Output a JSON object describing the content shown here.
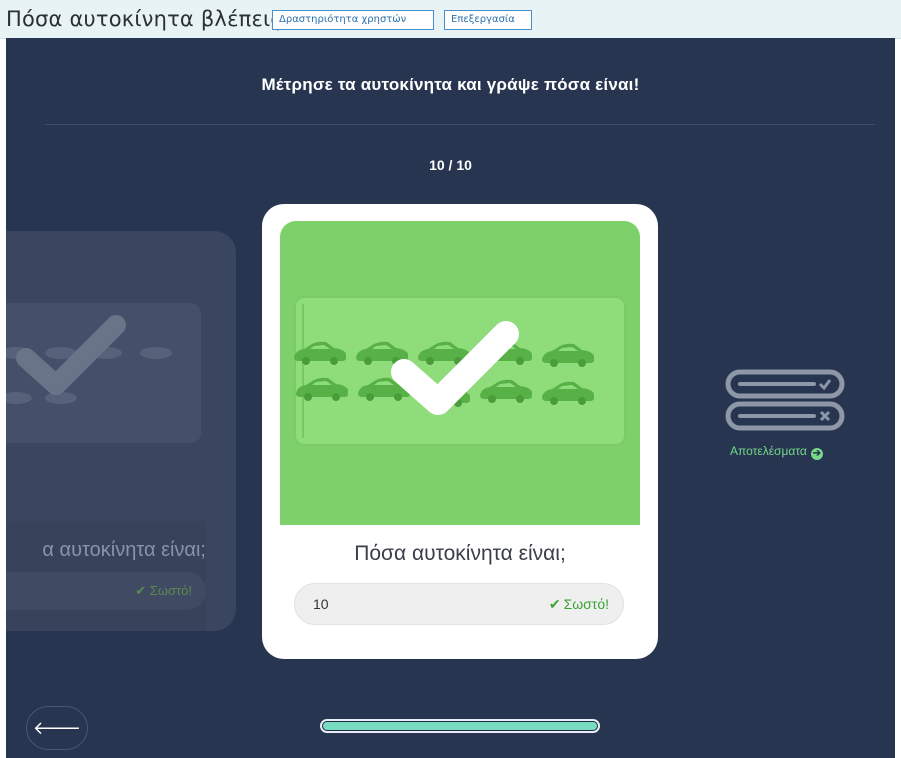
{
  "header": {
    "title": "Πόσα αυτοκίνητα βλέπεις;",
    "activity_button": "Δραστηριότητα χρηστών",
    "edit_button": "Επεξεργασία"
  },
  "main": {
    "instruction": "Μέτρησε τα αυτοκίνητα και γράψε πόσα είναι!",
    "counter": "10 / 10"
  },
  "previous_card": {
    "question": "α αυτοκίνητα είναι;",
    "status": "✔ Σωστό!"
  },
  "current_card": {
    "question": "Πόσα αυτοκίνητα είναι;",
    "answer_value": "10",
    "status": "Σωστό!",
    "status_icon": "check-icon",
    "car_count": 10
  },
  "results": {
    "label": "Αποτελέσματα",
    "icon": "results-list-icon"
  },
  "footer": {
    "back_icon": "arrow-left-icon",
    "progress": 1.0
  },
  "colors": {
    "background": "#283550",
    "card_image": "#7ed16a",
    "correct": "#3aa335",
    "accent": "#74d98a",
    "progress_fill": "#77dcc0"
  }
}
